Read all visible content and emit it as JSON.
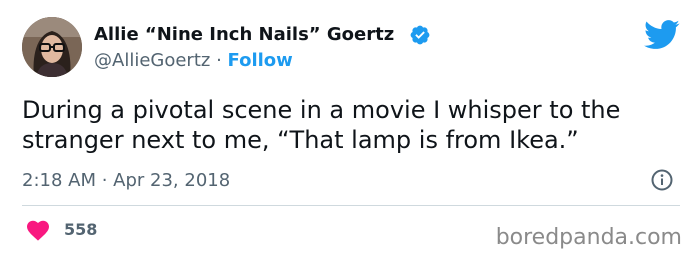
{
  "author": {
    "display_name": "Allie “Nine Inch Nails” Goertz",
    "handle": "@AllieGoertz",
    "separator": " · ",
    "follow_label": "Follow",
    "verified_icon": "verified-badge-icon"
  },
  "tweet": {
    "text": "During a pivotal scene in a movie I whisper to the stranger next to me, “That lamp is from Ikea.”",
    "timestamp": "2:18 AM · Apr 23, 2018"
  },
  "engagement": {
    "likes": "558"
  },
  "watermark": "boredpanda.com",
  "colors": {
    "accent": "#1d9bf0",
    "heart": "#f91880",
    "secondary_text": "#536471"
  }
}
